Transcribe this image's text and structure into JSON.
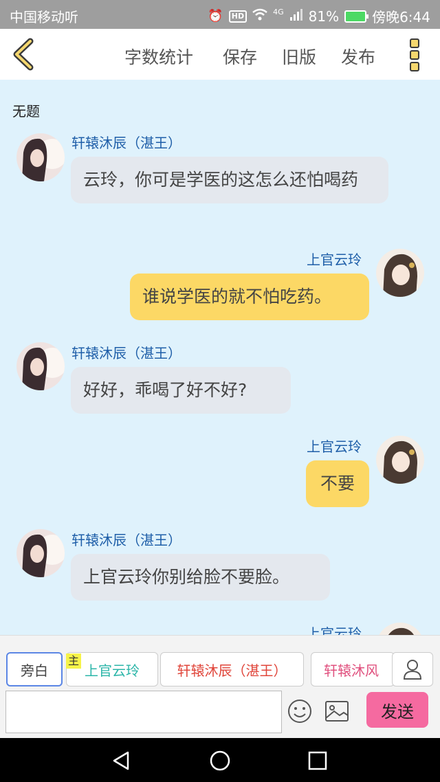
{
  "status_bar": {
    "carrier": "中国移动听",
    "network": "4G",
    "battery": "81%",
    "time": "傍晚6:44",
    "hd": "HD"
  },
  "toolbar": {
    "items": [
      "字数统计",
      "保存",
      "旧版",
      "发布"
    ]
  },
  "chat": {
    "title": "无题",
    "messages": [
      {
        "side": "left",
        "sender": "轩辕沐辰（湛王）",
        "text": "云玲，你可是学医的这怎么还怕喝药"
      },
      {
        "side": "right",
        "sender": "上官云玲",
        "text": "谁说学医的就不怕吃药。"
      },
      {
        "side": "left",
        "sender": "轩辕沐辰（湛王）",
        "text": "好好，乖喝了好不好?"
      },
      {
        "side": "right",
        "sender": "上官云玲",
        "text": "不要"
      },
      {
        "side": "left",
        "sender": "轩辕沐辰（湛王）",
        "text": "上官云玲你别给脸不要脸。"
      },
      {
        "side": "right",
        "sender": "上官云玲",
        "text": ""
      }
    ]
  },
  "composer": {
    "roles": [
      {
        "label": "旁白",
        "color": "#444444"
      },
      {
        "label": "上官云玲",
        "color": "#2bb5a8"
      },
      {
        "label": "轩辕沐辰（湛王）",
        "color": "#e0453a"
      },
      {
        "label": "轩辕沐风",
        "color": "#e0507e"
      }
    ],
    "master_tag": "主",
    "input_value": "",
    "send_label": "发送"
  },
  "colors": {
    "chat_bg": "#dff2fc",
    "left_bubble": "#e4e8ee",
    "right_bubble": "#fcd865",
    "sender_name": "#1e5ea8",
    "send_button": "#f56aa0"
  }
}
